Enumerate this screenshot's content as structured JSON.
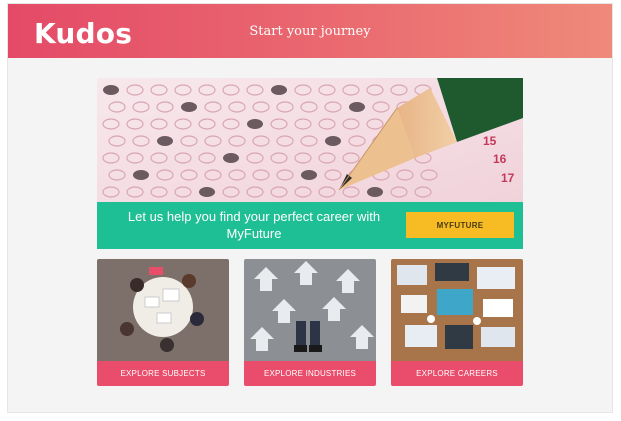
{
  "header": {
    "logo": "Kudos",
    "tagline": "Start your journey",
    "gradient_colors": [
      "#e44a67",
      "#ef8a7a"
    ]
  },
  "hero": {
    "image": "exam-answer-sheet-with-pencil",
    "sheet_numbers": [
      "15",
      "16",
      "17"
    ]
  },
  "cta": {
    "text": "Let us help you find your perfect career with MyFuture",
    "button_label": "MYFUTURE",
    "background": "#1fbf95",
    "button_color": "#f7bc24"
  },
  "cards": [
    {
      "image": "students-around-table-photo",
      "button_label": "EXPLORE SUBJECTS"
    },
    {
      "image": "arrows-on-floor-photo",
      "button_label": "EXPLORE INDUSTRIES"
    },
    {
      "image": "desk-workspace-photo",
      "button_label": "EXPLORE CAREERS"
    }
  ],
  "accent_color": "#ea4c6b"
}
